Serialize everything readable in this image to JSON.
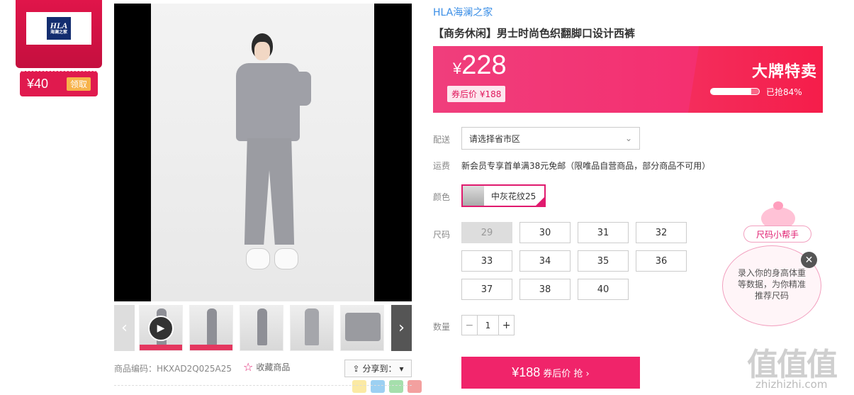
{
  "coupon": {
    "brand_logo_text": "HLA",
    "brand_logo_sub": "海澜之家",
    "amount": "¥40",
    "claim_label": "领取"
  },
  "gallery": {
    "prev_glyph": "‹",
    "next_glyph": "›",
    "play_glyph": "▶"
  },
  "meta": {
    "product_code": "商品编码：HKXAD2Q025A25",
    "favorite_label": "收藏商品",
    "share_label": "分享到："
  },
  "product": {
    "brand": "HLA海澜之家",
    "title": "【商务休闲】男士时尚色织翻脚口设计西裤"
  },
  "price": {
    "currency": "¥",
    "amount": "228",
    "after_coupon": "券后价 ¥188",
    "promo_title": "大牌特卖",
    "sold_fraction": 0.84,
    "sold_label": "已抢84%"
  },
  "delivery": {
    "label": "配送",
    "placeholder": "请选择省市区"
  },
  "shipping": {
    "label": "运费",
    "text": "新会员专享首单满38元免邮（限唯品自营商品，部分商品不可用）"
  },
  "color": {
    "label": "颜色",
    "selected": "中灰花纹25"
  },
  "size": {
    "label": "尺码",
    "options": [
      "29",
      "30",
      "31",
      "32",
      "33",
      "34",
      "35",
      "36",
      "37",
      "38",
      "40"
    ],
    "disabled": [
      "29"
    ]
  },
  "quantity": {
    "label": "数量",
    "value": "1",
    "minus": "−",
    "plus": "+"
  },
  "buy": {
    "price": "¥188",
    "suffix": "券后价 抢 ›"
  },
  "helper": {
    "title": "尺码小帮手",
    "text": "录入你的身高体重等数据，为你精准推荐尺码",
    "close_glyph": "✕"
  },
  "watermark": {
    "logo": "值值值",
    "url": "zhizhizhi.com"
  },
  "colors": {
    "accent": "#f0246a",
    "link": "#3a8ee6",
    "coupon_red": "#e0154a"
  }
}
